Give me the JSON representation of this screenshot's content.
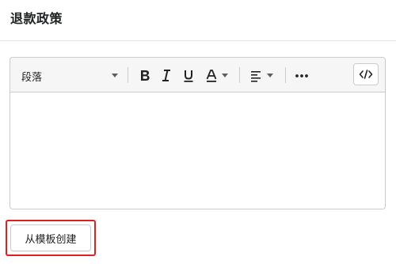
{
  "section": {
    "title": "退款政策"
  },
  "editor": {
    "format_select": {
      "value": "段落",
      "icon": "chevron-down-icon"
    },
    "toolbar": {
      "bold_icon": "bold-icon",
      "italic_icon": "italic-icon",
      "underline_icon": "underline-icon",
      "text_color_icon": "text-color-icon",
      "align_icon": "align-left-icon",
      "more_icon": "more-horizontal-icon",
      "code_icon": "code-view-icon"
    },
    "body_text": ""
  },
  "actions": {
    "create_from_template_label": "从模板创建"
  },
  "colors": {
    "highlight_border": "#e02020",
    "border": "#c9cccf",
    "toolbar_bg": "#f6f6f7"
  }
}
